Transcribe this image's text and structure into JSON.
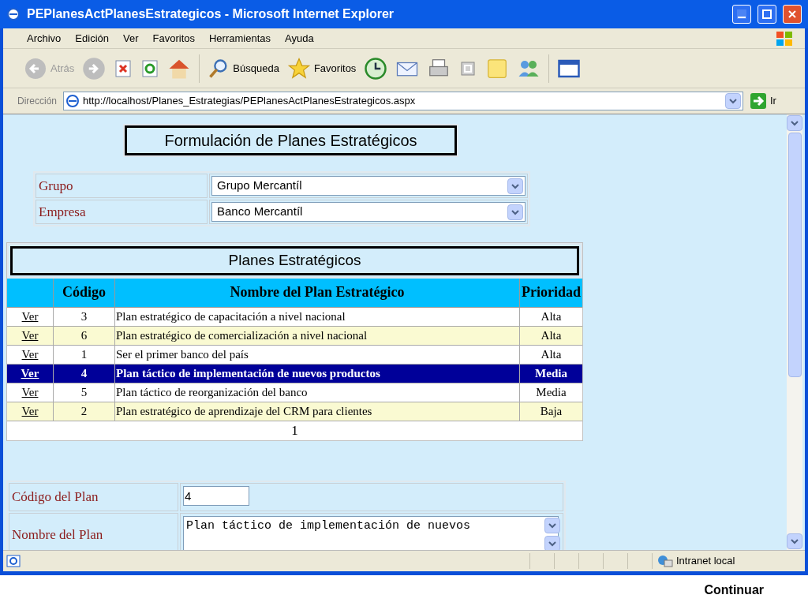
{
  "window": {
    "title": "PEPlanesActPlanesEstrategicos - Microsoft Internet Explorer"
  },
  "menu": [
    "Archivo",
    "Edición",
    "Ver",
    "Favoritos",
    "Herramientas",
    "Ayuda"
  ],
  "toolbar": {
    "back": {
      "label": "Atrás",
      "disabled": true
    },
    "search": "Búsqueda",
    "favorites": "Favoritos"
  },
  "address": {
    "label": "Dirección",
    "url": "http://localhost/Planes_Estrategias/PEPlanesActPlanesEstrategicos.aspx",
    "go": "Ir"
  },
  "page_title": "Formulación de Planes Estratégicos",
  "filters": [
    {
      "label": "Grupo",
      "value": "Grupo Mercantíl"
    },
    {
      "label": "Empresa",
      "value": "Banco Mercantíl"
    }
  ],
  "plans": {
    "title": "Planes Estratégicos",
    "columns": [
      "Código",
      "Nombre del Plan Estratégico",
      "Prioridad"
    ],
    "rows": [
      {
        "link": "Ver",
        "code": "3",
        "name": "Plan estratégico de capacitación a nivel nacional",
        "priority": "Alta",
        "selected": false
      },
      {
        "link": "Ver",
        "code": "6",
        "name": "Plan estratégico de comercialización a nivel nacional",
        "priority": "Alta",
        "selected": false
      },
      {
        "link": "Ver",
        "code": "1",
        "name": "Ser el primer banco del país",
        "priority": "Alta",
        "selected": false
      },
      {
        "link": "Ver",
        "code": "4",
        "name": "Plan táctico de implementación de nuevos productos",
        "priority": "Media",
        "selected": true
      },
      {
        "link": "Ver",
        "code": "5",
        "name": "Plan táctico de reorganización del banco",
        "priority": "Media",
        "selected": false
      },
      {
        "link": "Ver",
        "code": "2",
        "name": "Plan estratégico de aprendizaje del CRM para clientes",
        "priority": "Baja",
        "selected": false
      }
    ],
    "pager": "1"
  },
  "form": [
    {
      "kind": "input",
      "label": "Código del Plan",
      "value": "4"
    },
    {
      "kind": "textarea",
      "label": "Nombre del Plan",
      "value": "Plan táctico de implementación de nuevos"
    }
  ],
  "status_bar": {
    "zone": "Intranet local"
  },
  "footer": "Continuar"
}
